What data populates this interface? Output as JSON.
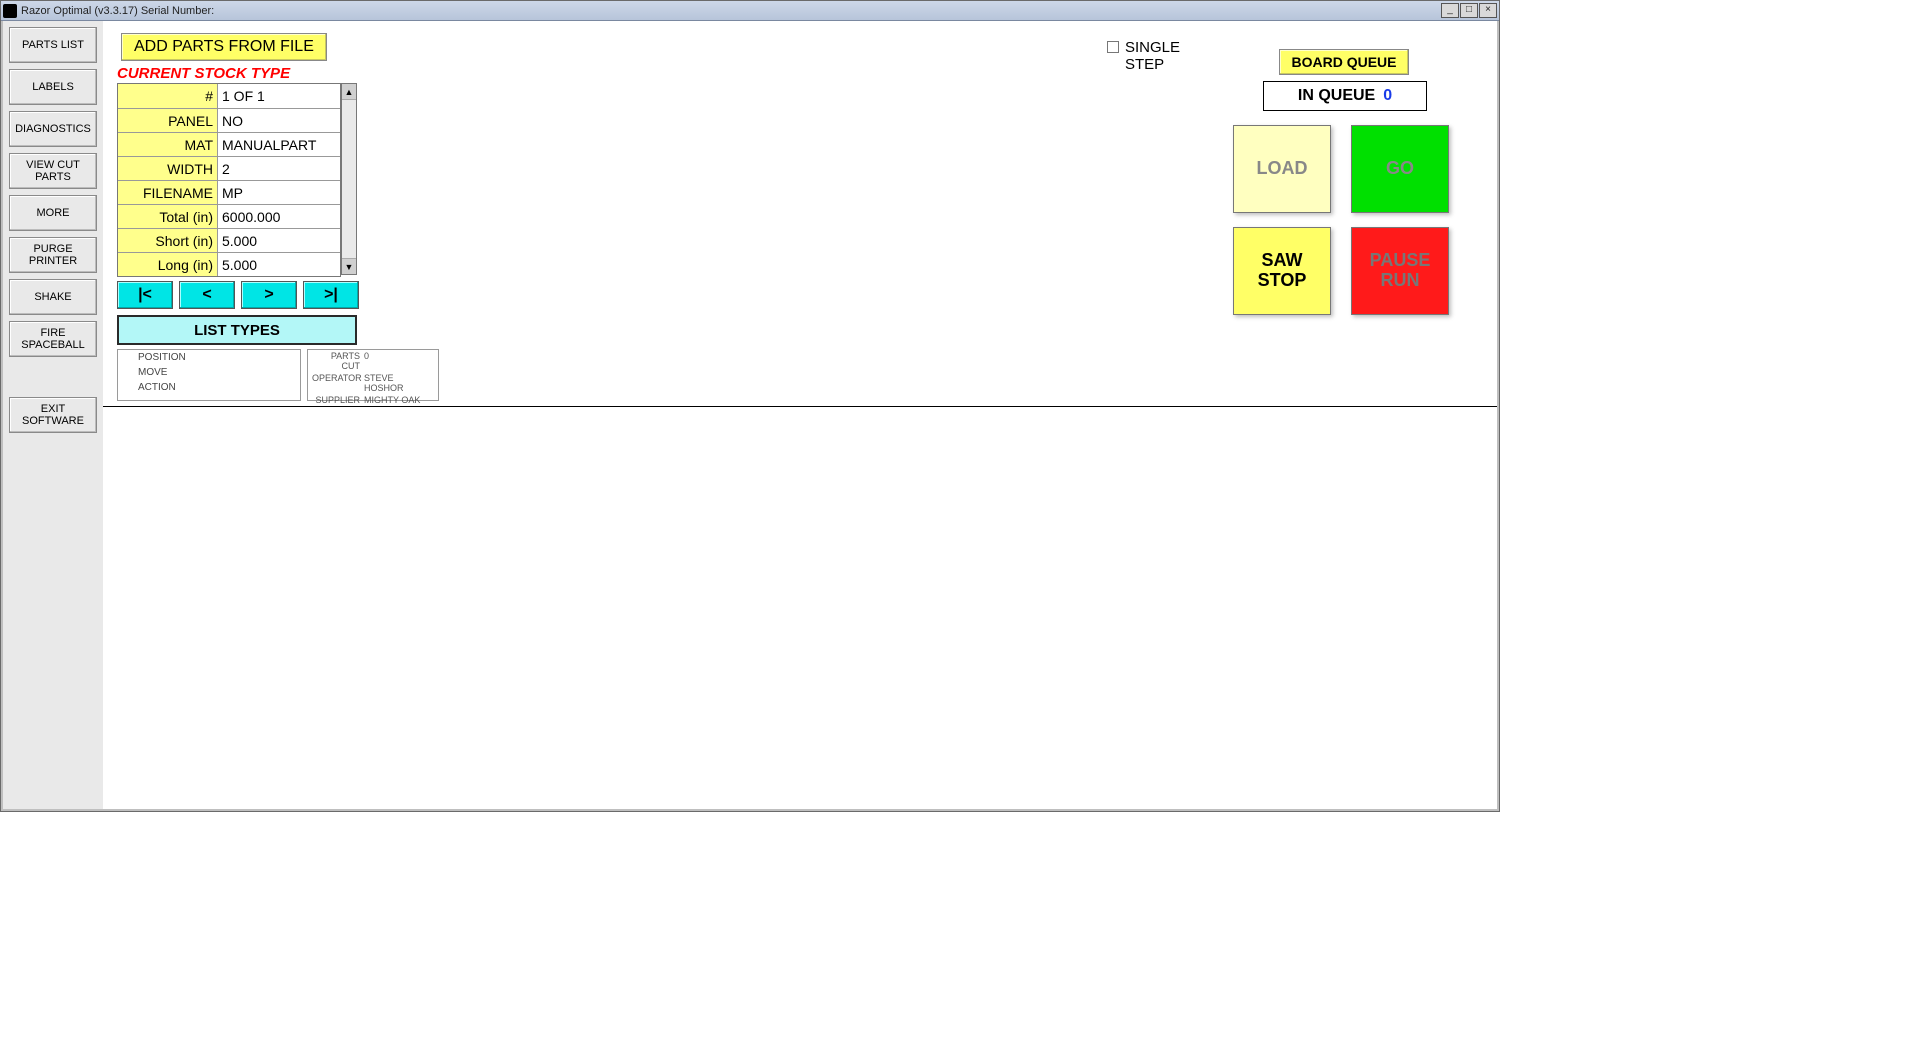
{
  "window": {
    "title": "Razor Optimal (v3.3.17)  Serial Number:"
  },
  "sidebar": {
    "items": [
      "PARTS LIST",
      "LABELS",
      "DIAGNOSTICS",
      "VIEW CUT\nPARTS",
      "MORE",
      "PURGE\nPRINTER",
      "SHAKE",
      "FIRE\nSPACEBALL"
    ],
    "exit": "EXIT\nSOFTWARE"
  },
  "main": {
    "addParts": "ADD PARTS FROM FILE",
    "stockHeading": "CURRENT STOCK TYPE",
    "stockRows": [
      {
        "label": "#",
        "value": "1 OF 1"
      },
      {
        "label": "PANEL",
        "value": "NO"
      },
      {
        "label": "MAT",
        "value": "MANUALPART"
      },
      {
        "label": "WIDTH",
        "value": "2"
      },
      {
        "label": "FILENAME",
        "value": "MP"
      },
      {
        "label": "Total (in)",
        "value": "6000.000"
      },
      {
        "label": "Short (in)",
        "value": "5.000"
      },
      {
        "label": "Long (in)",
        "value": "5.000"
      }
    ],
    "nav": {
      "first": "|<",
      "prev": "<",
      "next": ">",
      "last": ">|"
    },
    "listTypes": "LIST TYPES",
    "statusLeft": {
      "position": "POSITION",
      "move": "MOVE",
      "action": "ACTION"
    },
    "statusRight": {
      "partsCutLabel": "PARTS CUT",
      "partsCutValue": "0",
      "operatorLabel": "OPERATOR",
      "operatorValue": "STEVE HOSHOR",
      "supplierLabel": "SUPPLIER",
      "supplierValue": "MIGHTY OAK"
    }
  },
  "right": {
    "singleStep": "SINGLE\nSTEP",
    "boardQueue": "BOARD QUEUE",
    "inQueueLabel": "IN QUEUE",
    "inQueueValue": "0",
    "load": "LOAD",
    "go": "GO",
    "sawStop": "SAW\nSTOP",
    "pauseRun": "PAUSE\nRUN"
  }
}
